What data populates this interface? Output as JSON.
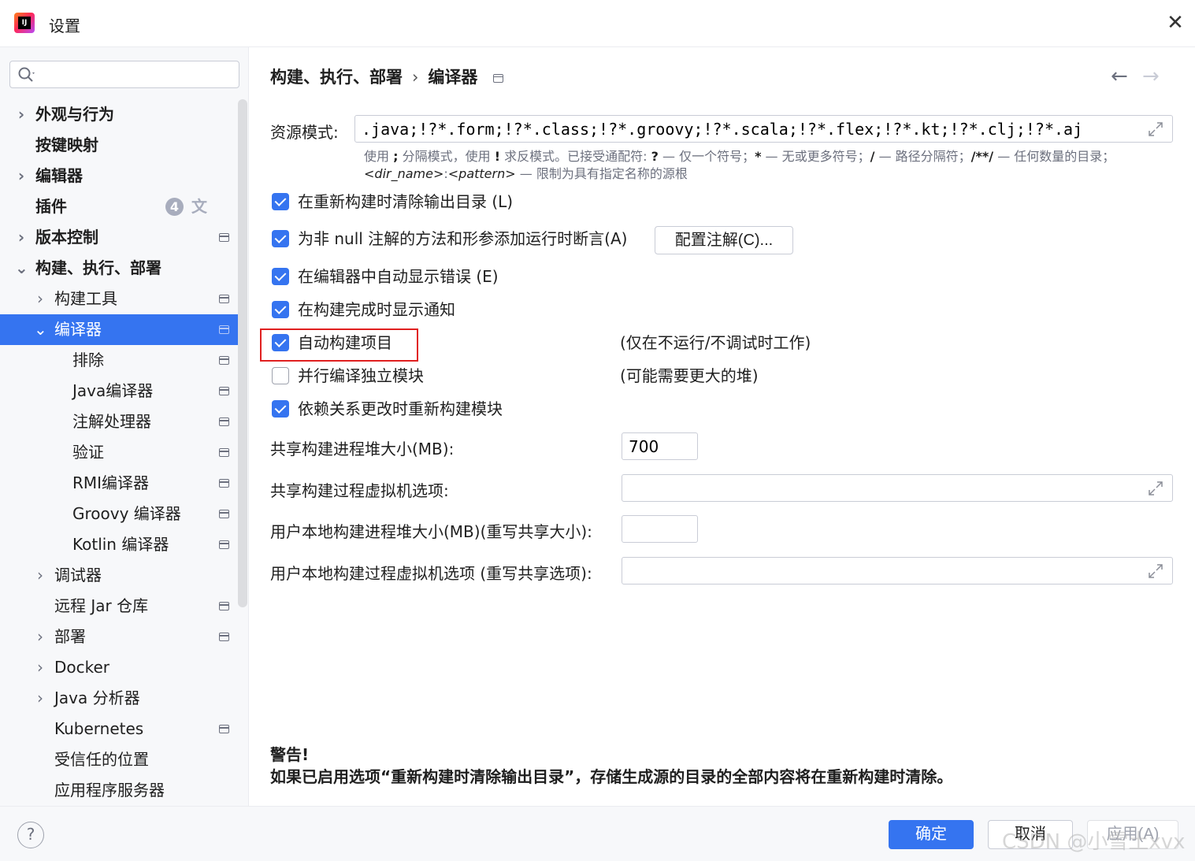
{
  "window": {
    "title": "设置",
    "logo_text": "IJ"
  },
  "sidebar": {
    "search_placeholder": "",
    "items": [
      {
        "label": "外观与行为"
      },
      {
        "label": "按键映射"
      },
      {
        "label": "编辑器"
      },
      {
        "label": "插件",
        "badge": "4"
      },
      {
        "label": "版本控制"
      },
      {
        "label": "构建、执行、部署"
      },
      {
        "label": "构建工具"
      },
      {
        "label": "编译器"
      },
      {
        "label": "排除"
      },
      {
        "label": "Java编译器"
      },
      {
        "label": "注解处理器"
      },
      {
        "label": "验证"
      },
      {
        "label": "RMI编译器"
      },
      {
        "label": "Groovy 编译器"
      },
      {
        "label": "Kotlin 编译器"
      },
      {
        "label": "调试器"
      },
      {
        "label": "远程 Jar 仓库"
      },
      {
        "label": "部署"
      },
      {
        "label": "Docker"
      },
      {
        "label": "Java 分析器"
      },
      {
        "label": "Kubernetes"
      },
      {
        "label": "受信任的位置"
      },
      {
        "label": "应用程序服务器"
      }
    ]
  },
  "header": {
    "breadcrumb_parent": "构建、执行、部署",
    "breadcrumb_sep": "›",
    "breadcrumb_current": "编译器",
    "back_arrow": "←",
    "forward_arrow": "→"
  },
  "resource_patterns": {
    "label": "资源模式:",
    "value": ".java;!?*.form;!?*.class;!?*.groovy;!?*.scala;!?*.flex;!?*.kt;!?*.clj;!?*.aj",
    "hint": {
      "p1": "使用",
      "b1": ";",
      "p2": "分隔模式，使用",
      "b2": "!",
      "p3": "求反模式。已接受通配符:",
      "b3": "?",
      "p4": "— 仅一个符号；",
      "b4": "*",
      "p5": "— 无或更多符号；",
      "b5": "/",
      "p6": "— 路径分隔符；",
      "b6": "/**/",
      "p7": "— 任何数量的目录；",
      "i1": "<dir_name>",
      "p8": ":",
      "i2": "<pattern>",
      "p9": "— 限制为具有指定名称的源根"
    }
  },
  "options": [
    {
      "label": "在重新构建时清除输出目录 (L)",
      "checked": true
    },
    {
      "label": "为非 null 注解的方法和形参添加运行时断言(A)",
      "checked": true
    },
    {
      "label": "在编辑器中自动显示错误 (E)",
      "checked": true
    },
    {
      "label": "在构建完成时显示通知",
      "checked": true
    },
    {
      "label": "自动构建项目",
      "checked": true,
      "note": "(仅在不运行/不调试时工作)"
    },
    {
      "label": "并行编译独立模块",
      "checked": false,
      "note": "(可能需要更大的堆)"
    },
    {
      "label": "依赖关系更改时重新构建模块",
      "checked": true
    }
  ],
  "configure_annotations_button": "配置注解(C)...",
  "fields": {
    "shared_heap": {
      "label": "共享构建进程堆大小(MB):",
      "value": "700"
    },
    "shared_vm": {
      "label": "共享构建过程虚拟机选项:",
      "value": ""
    },
    "user_heap": {
      "label": "用户本地构建进程堆大小(MB)(重写共享大小):",
      "value": ""
    },
    "user_vm": {
      "label": "用户本地构建过程虚拟机选项 (重写共享选项):",
      "value": ""
    }
  },
  "warning": {
    "title": "警告!",
    "text": "如果已启用选项“重新构建时清除输出目录”，存储生成源的目录的全部内容将在重新构建时清除。"
  },
  "footer": {
    "help": "?",
    "ok": "确定",
    "cancel": "取消",
    "apply": "应用(A)",
    "watermark": "CSDN @小雪土xvx"
  },
  "colors": {
    "accent": "#3574f0",
    "highlight": "#e02020"
  }
}
